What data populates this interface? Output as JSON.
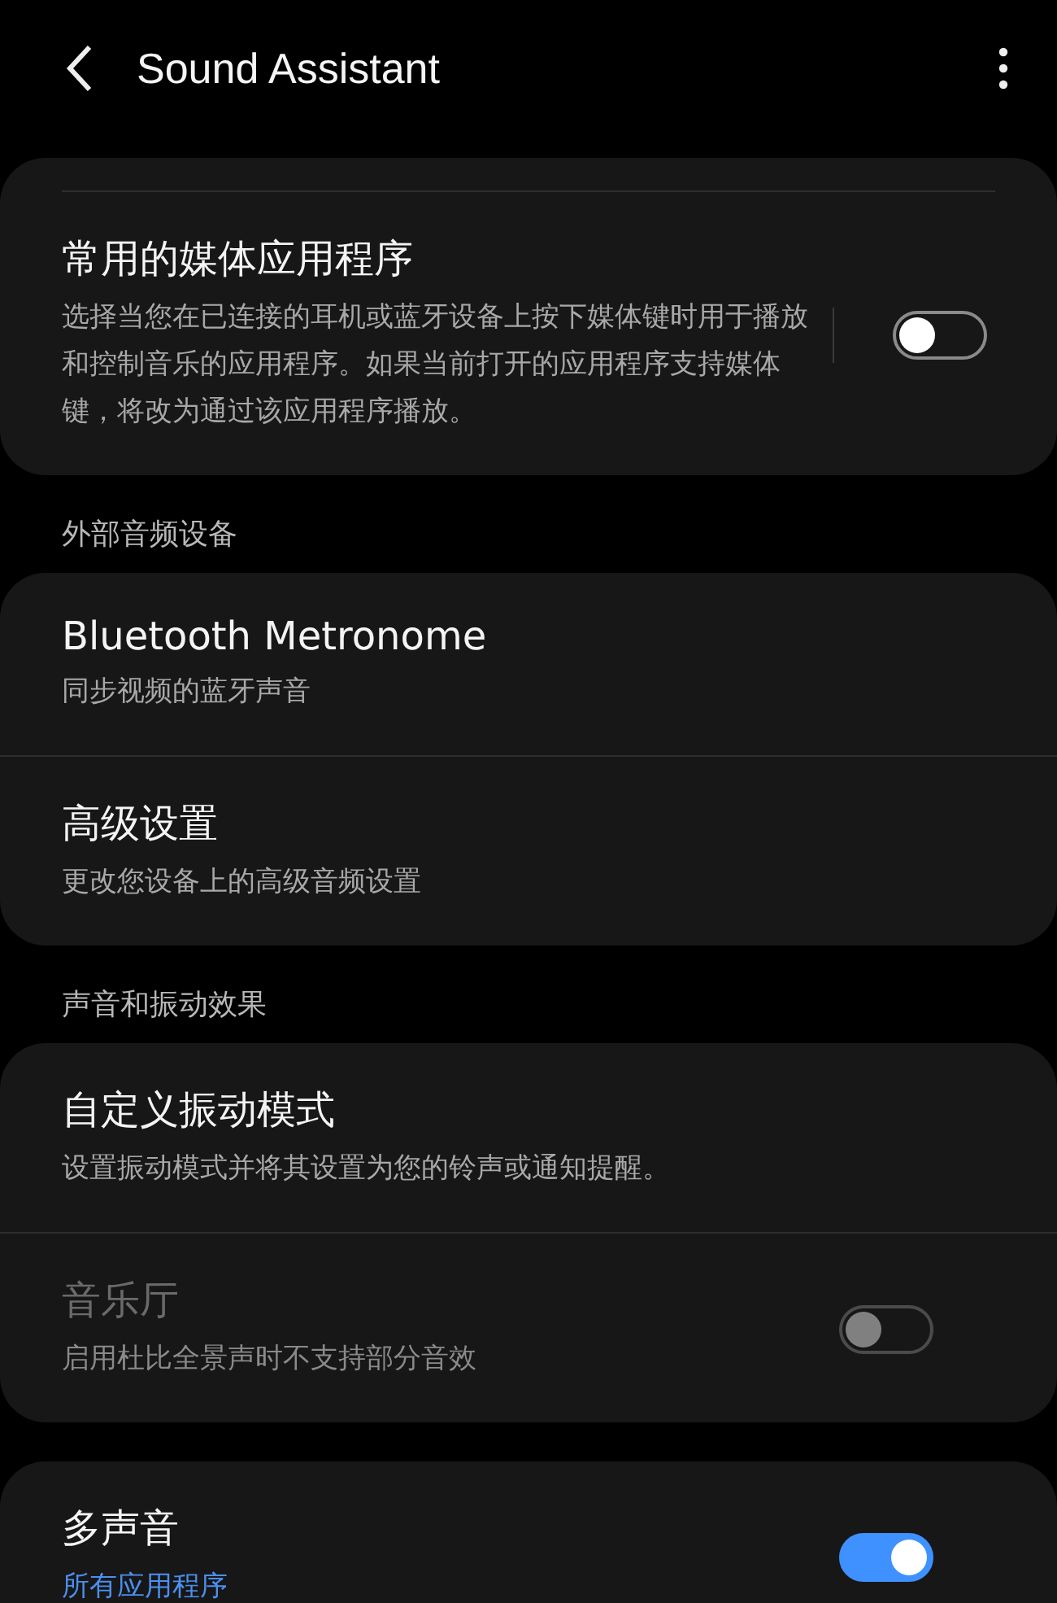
{
  "header": {
    "title": "Sound Assistant"
  },
  "groups": [
    {
      "cut_top": true,
      "items": [
        {
          "kind": "split-switch",
          "title": "常用的媒体应用程序",
          "subtitle": "选择当您在已连接的耳机或蓝牙设备上按下媒体键时用于播放和控制音乐的应用程序。如果当前打开的应用程序支持媒体键，将改为通过该应用程序播放。",
          "on": false,
          "disabled": false,
          "accent": false
        }
      ]
    },
    {
      "heading": "外部音频设备",
      "cut_top": false,
      "items": [
        {
          "kind": "nav",
          "title": "Bluetooth Metronome",
          "subtitle": "同步视频的蓝牙声音",
          "disabled": false,
          "accent": false
        },
        {
          "kind": "nav",
          "title": "高级设置",
          "subtitle": "更改您设备上的高级音频设置",
          "disabled": false,
          "accent": false
        }
      ]
    },
    {
      "heading": "声音和振动效果",
      "cut_top": false,
      "items": [
        {
          "kind": "nav",
          "title": "自定义振动模式",
          "subtitle": "设置振动模式并将其设置为您的铃声或通知提醒。",
          "disabled": false,
          "accent": false
        },
        {
          "kind": "switch",
          "title": "音乐厅",
          "subtitle": "启用杜比全景声时不支持部分音效",
          "on": false,
          "disabled": true,
          "accent": false
        }
      ]
    },
    {
      "cut_top": false,
      "items": [
        {
          "kind": "switch",
          "title": "多声音",
          "subtitle": "所有应用程序",
          "on": true,
          "disabled": false,
          "accent": true
        }
      ]
    }
  ]
}
